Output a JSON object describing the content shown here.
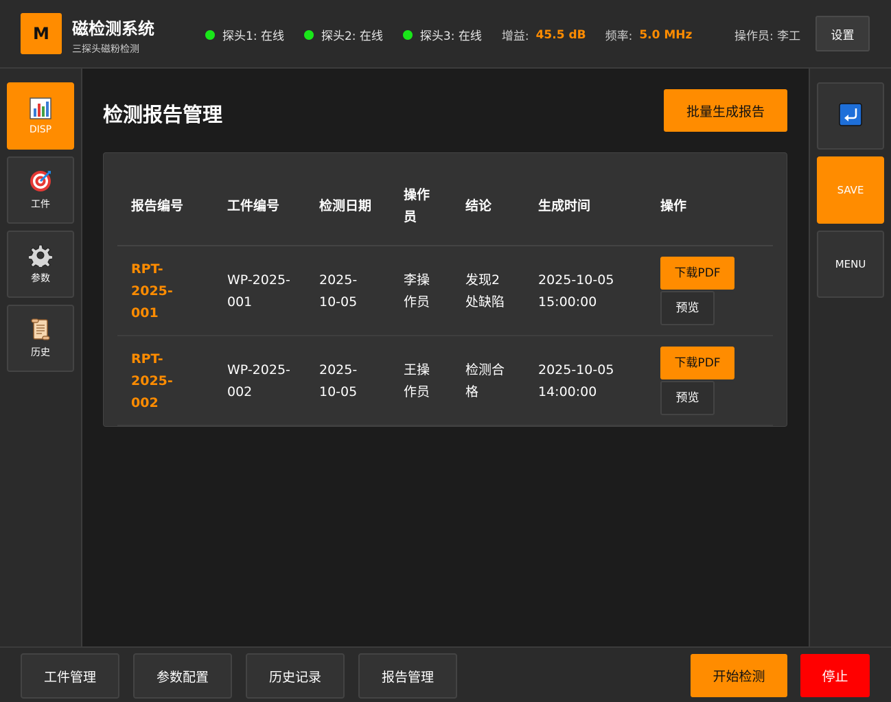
{
  "header": {
    "logo_letter": "M",
    "title": "磁检测系统",
    "subtitle": "三探头磁粉检测",
    "probes": [
      {
        "label": "探头1: 在线",
        "status_color": "#19e619"
      },
      {
        "label": "探头2: 在线",
        "status_color": "#19e619"
      },
      {
        "label": "探头3: 在线",
        "status_color": "#19e619"
      }
    ],
    "gain_label": "增益:",
    "gain_value": "45.5 dB",
    "freq_label": "频率:",
    "freq_value": "5.0 MHz",
    "operator": "操作员: 李工",
    "settings_label": "设置"
  },
  "left_nav": [
    {
      "label": "DISP",
      "icon": "bar-chart-icon",
      "active": true
    },
    {
      "label": "工件",
      "icon": "target-icon",
      "active": false
    },
    {
      "label": "参数",
      "icon": "gear-icon",
      "active": false
    },
    {
      "label": "历史",
      "icon": "scroll-icon",
      "active": false
    }
  ],
  "right_nav": [
    {
      "label": "",
      "icon": "return-icon"
    },
    {
      "label": "SAVE",
      "icon": ""
    },
    {
      "label": "MENU",
      "icon": ""
    }
  ],
  "main": {
    "title": "检测报告管理",
    "batch_button": "批量生成报告",
    "table": {
      "headers": [
        "报告编号",
        "工件编号",
        "检测日期",
        "操作员",
        "结论",
        "生成时间",
        "操作"
      ],
      "rows": [
        {
          "id": "RPT-2025-001",
          "workpiece": "WP-2025-001",
          "date": "2025-10-05",
          "operator": "李操作员",
          "result": "发现2处缺陷",
          "generated": "2025-10-05 15:00:00",
          "pdf": "下载PDF",
          "preview": "预览"
        },
        {
          "id": "RPT-2025-002",
          "workpiece": "WP-2025-002",
          "date": "2025-10-05",
          "operator": "王操作员",
          "result": "检测合格",
          "generated": "2025-10-05 14:00:00",
          "pdf": "下载PDF",
          "preview": "预览"
        }
      ]
    }
  },
  "bottom": {
    "buttons": [
      "工件管理",
      "参数配置",
      "历史记录",
      "报告管理"
    ],
    "start": "开始检测",
    "stop": "停止"
  },
  "colors": {
    "accent": "#ff8c00",
    "danger": "#ff0000",
    "online": "#19e619",
    "background": "#1c1c1c",
    "panel": "#333333"
  }
}
